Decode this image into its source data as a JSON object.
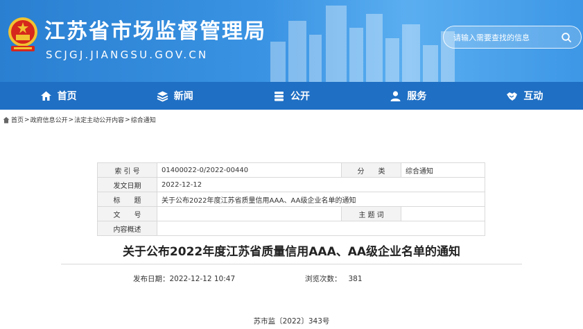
{
  "header": {
    "site_title": "江苏省市场监督管理局",
    "site_domain": "SCJGJ.JIANGSU.GOV.CN",
    "search_placeholder": "请输入需要查找的信息"
  },
  "nav": {
    "items": [
      {
        "label": "首页",
        "icon": "home-icon"
      },
      {
        "label": "新闻",
        "icon": "layers-icon"
      },
      {
        "label": "公开",
        "icon": "stack-icon"
      },
      {
        "label": "服务",
        "icon": "user-icon"
      },
      {
        "label": "互动",
        "icon": "handshake-icon"
      }
    ]
  },
  "breadcrumb": {
    "items": [
      "首页",
      "政府信息公开",
      "法定主动公开内容",
      "综合通知"
    ],
    "separator": ">"
  },
  "info": {
    "index_label": "索 引 号",
    "index_value": "01400022-0/2022-00440",
    "category_label": "分　　类",
    "category_value": "综合通知",
    "date_label": "发文日期",
    "date_value": "2022-12-12",
    "title_label": "标　　题",
    "title_value": "关于公布2022年度江苏省质量信用AAA、AA级企业名单的通知",
    "docno_label": "文　　号",
    "docno_value": "",
    "subject_label": "主 题 词",
    "subject_value": "",
    "summary_label": "内容概述",
    "summary_value": ""
  },
  "article": {
    "title": "关于公布2022年度江苏省质量信用AAA、AA级企业名单的通知",
    "publish_label": "发布日期：",
    "publish_value": "2022-12-12 10:47",
    "views_label": "浏览次数：",
    "views_value": "381",
    "doc_number": "苏市监〔2022〕343号"
  },
  "colors": {
    "header_blue": "#2a7fd1",
    "nav_blue": "#1f6fc4"
  }
}
